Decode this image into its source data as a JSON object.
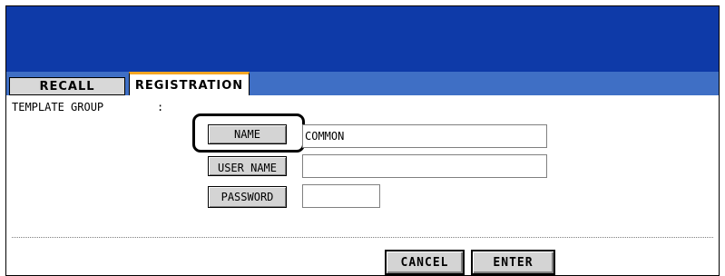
{
  "tabs": [
    {
      "label": "RECALL",
      "active": false
    },
    {
      "label": "REGISTRATION",
      "active": true
    }
  ],
  "template_group": {
    "label": "TEMPLATE GROUP",
    "separator": ":"
  },
  "fields": {
    "name": {
      "button": "NAME",
      "value": "COMMON"
    },
    "user_name": {
      "button": "USER NAME",
      "value": ""
    },
    "password": {
      "button": "PASSWORD",
      "value": ""
    }
  },
  "actions": {
    "cancel": "CANCEL",
    "enter": "ENTER"
  },
  "colors": {
    "header": "#0e3aa8",
    "tabbar": "#3f6fc5",
    "active_tab_accent": "#f5a623",
    "button": "#d4d4d4"
  }
}
